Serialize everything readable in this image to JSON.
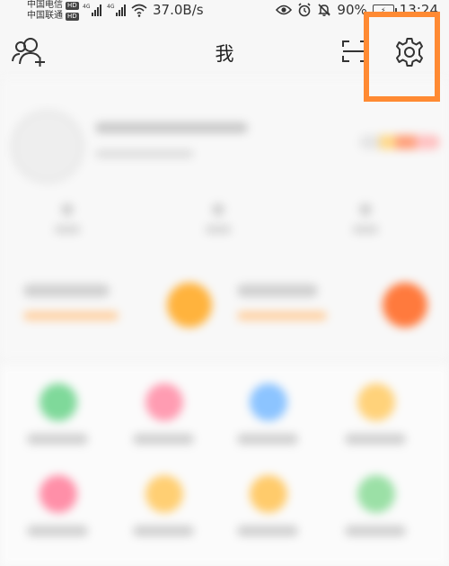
{
  "status": {
    "carrier1": "中国电信",
    "carrier2": "中国联通",
    "hd": "HD",
    "net_type": "4G",
    "speed": "37.0B/s",
    "battery": "90%",
    "time": "13:24"
  },
  "header": {
    "title": "我",
    "icons": [
      "add-user-icon",
      "scan-icon",
      "settings-icon"
    ]
  },
  "colors": {
    "highlight": "#ff8a33",
    "background": "#f6f6f6"
  }
}
